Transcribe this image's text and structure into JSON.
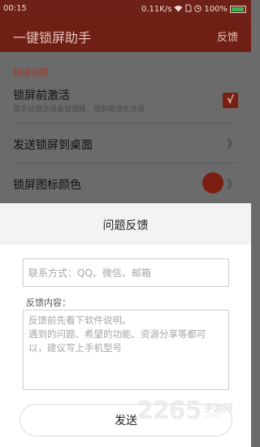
{
  "status_bar": {
    "time": "00:15",
    "network_speed": "0.11K/s",
    "battery_percent": "100%",
    "icons": [
      "wifi-icon",
      "sim-icon",
      "clock-icon",
      "battery-icon"
    ]
  },
  "app_bar": {
    "title": "一键锁屏助手",
    "action": "反馈"
  },
  "settings": {
    "section_title": "快捷锁屏",
    "activate": {
      "title": "锁屏前激活",
      "subtitle": "需手动激活设备管理器，想卸载请先关闭",
      "checked": true
    },
    "send_to_desktop": {
      "title": "发送锁屏到桌面"
    },
    "icon_color": {
      "title": "锁屏图标颜色",
      "color": "#7a1f12"
    }
  },
  "dialog": {
    "title": "问题反馈",
    "contact_placeholder": "联系方式：QQ、微信、邮箱",
    "feedback_label": "反馈内容：",
    "feedback_placeholder": "反馈前先看下软件说明。\n遇到的问题、希望的功能、资源分享等都可以，建议写上手机型号",
    "send_label": "发送"
  },
  "watermark": {
    "number": "2265",
    "text": "手游网",
    "domain": ".com"
  },
  "colors": {
    "accent": "#701f14",
    "section": "#9e3a2f"
  }
}
